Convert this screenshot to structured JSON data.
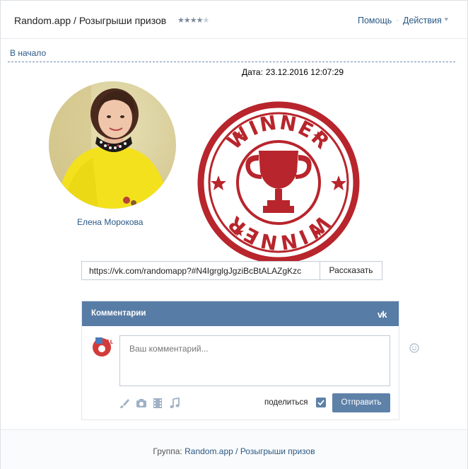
{
  "header": {
    "title": "Random.app / Розыгрыши призов",
    "rating_stars": 4,
    "rating_max": 5,
    "help": "Помощь",
    "actions": "Действия"
  },
  "nav": {
    "back": "В начало"
  },
  "draw": {
    "date_label": "Дата:",
    "date_value": "23.12.2016 12:07:29",
    "winner_name": "Елена Морокова",
    "stamp_text": "WINNER"
  },
  "share": {
    "url": "https://vk.com/randomapp?#N4IgrglgJgziBcBtALAZgKzc",
    "button": "Рассказать"
  },
  "comments": {
    "title": "Комментарии",
    "logo": "vk",
    "placeholder": "Ваш комментарий...",
    "share_label": "поделиться",
    "share_checked": true,
    "send": "Отправить",
    "tools": [
      "brush-icon",
      "camera-icon",
      "video-icon",
      "music-icon"
    ]
  },
  "footer": {
    "prefix": "Группа:",
    "group": "Random.app / Розыгрыши призов"
  },
  "colors": {
    "link": "#2a5885",
    "accent": "#5e81a8",
    "header_bar": "#577ca5",
    "stamp": "#b8252c"
  }
}
